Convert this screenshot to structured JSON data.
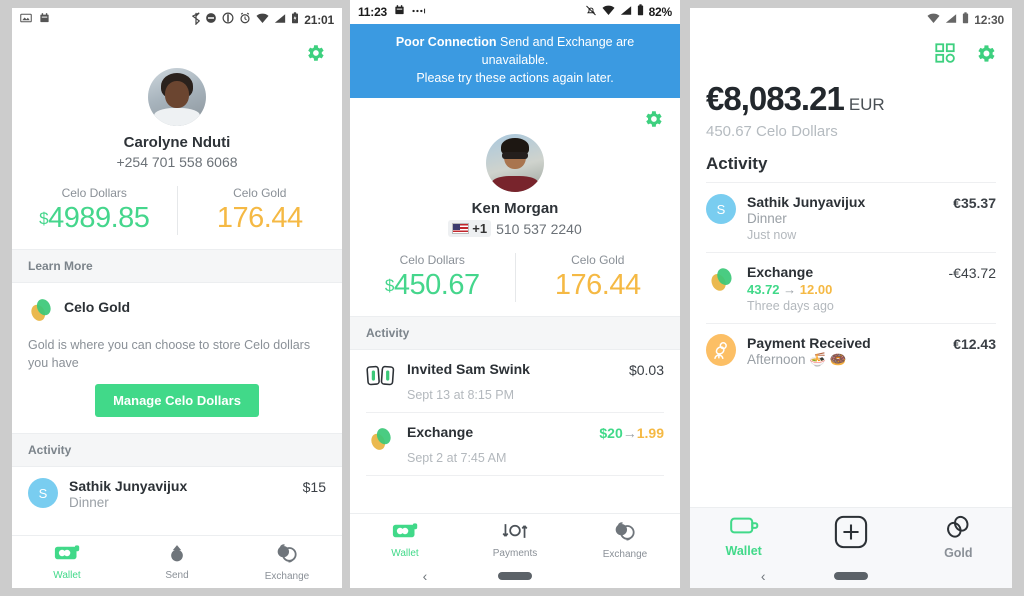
{
  "theme": {
    "green": "#41d989",
    "gold": "#f5b944",
    "banner_blue": "#3b9ae1",
    "avatar_blue": "#79cdf0",
    "avatar_orange": "#fcbf65",
    "page_bg": "#cccccc"
  },
  "phone1": {
    "statusbar": {
      "left_icons": [
        "image-icon",
        "calendar-icon"
      ],
      "right_icons": [
        "bluetooth-icon",
        "dnd-icon",
        "vibrate-icon",
        "alarm-icon",
        "wifi-icon",
        "signal-icon",
        "battery-icon"
      ],
      "time": "21:01"
    },
    "header": {
      "gear_icon": "gear-icon"
    },
    "profile": {
      "name": "Carolyne Nduti",
      "phone": "+254 701 558 6068"
    },
    "balances": [
      {
        "label": "Celo Dollars",
        "currency": "$",
        "value": "4989.85",
        "color": "green"
      },
      {
        "label": "Celo Gold",
        "currency": "",
        "value": "176.44",
        "color": "gold"
      }
    ],
    "learn_more": {
      "section_label": "Learn More",
      "card_icon": "celo-gold-icon",
      "title": "Celo Gold",
      "description": "Gold is where you can choose to store Celo dollars you have",
      "button_label": "Manage Celo Dollars"
    },
    "activity": {
      "section_label": "Activity",
      "rows": [
        {
          "icon": "avatar-initial",
          "initial": "S",
          "title": "Sathik Junyavijux",
          "subtitle": "Dinner",
          "amount": "$15"
        }
      ]
    },
    "tabs": [
      {
        "label": "Wallet",
        "icon": "wallet-icon",
        "active": true
      },
      {
        "label": "Send",
        "icon": "send-up-arrow-icon",
        "active": false
      },
      {
        "label": "Exchange",
        "icon": "exchange-icon",
        "active": false
      }
    ]
  },
  "phone2": {
    "statusbar": {
      "time": "11:23",
      "left_icons": [
        "calendar-icon",
        "more-dots-icon"
      ],
      "right_icons": [
        "notifications-off-icon",
        "wifi-icon",
        "signal-icon",
        "battery-icon"
      ],
      "battery": "82%"
    },
    "banner": {
      "bold": "Poor Connection",
      "rest": " Send and Exchange are unavailable.",
      "line2": "Please try these actions again later."
    },
    "header": {
      "gear_icon": "gear-icon"
    },
    "profile": {
      "name": "Ken Morgan",
      "country_code": "+1",
      "flag": "us-flag-icon",
      "phone": "510 537 2240"
    },
    "balances": [
      {
        "label": "Celo Dollars",
        "currency": "$",
        "value": "450.67",
        "color": "green"
      },
      {
        "label": "Celo Gold",
        "currency": "",
        "value": "176.44",
        "color": "gold"
      }
    ],
    "activity": {
      "section_label": "Activity",
      "rows": [
        {
          "icon": "invite-cards-icon",
          "title": "Invited Sam Swink",
          "amount": "$0.03",
          "subtitle": "Sept 13 at 8:15 PM"
        },
        {
          "icon": "celo-gold-icon",
          "title": "Exchange",
          "amount_from": "$20",
          "amount_arrow": "→",
          "amount_to": "1.99",
          "subtitle": "Sept 2 at 7:45 AM"
        }
      ]
    },
    "tabs": [
      {
        "label": "Wallet",
        "icon": "wallet-icon",
        "active": true
      },
      {
        "label": "Payments",
        "icon": "payments-arrows-icon",
        "active": false
      },
      {
        "label": "Exchange",
        "icon": "exchange-icon",
        "active": false
      }
    ],
    "sysnav": {
      "back": "‹",
      "home_pill": "home-pill-icon"
    }
  },
  "phone3": {
    "statusbar": {
      "right_icons": [
        "wifi-icon",
        "signal-icon",
        "battery-icon"
      ],
      "time": "12:30"
    },
    "header": {
      "qr_icon": "qr-scan-icon",
      "gear_icon": "gear-icon"
    },
    "balance": {
      "amount": "€8,083.21",
      "unit": "EUR",
      "sub": "450.67 Celo Dollars"
    },
    "activity": {
      "section_label": "Activity",
      "rows": [
        {
          "icon": "avatar-initial",
          "initial": "S",
          "title": "Sathik Junyavijux",
          "subtitle": "Dinner",
          "time": "Just now",
          "amount": "€35.37"
        },
        {
          "icon": "celo-gold-icon",
          "title": "Exchange",
          "exch_from": "43.72",
          "exch_arrow": "→",
          "exch_to": "12.00",
          "time": "Three days ago",
          "amount": "-€43.72"
        },
        {
          "icon": "payment-received-icon",
          "title": "Payment Received",
          "subtitle": "Afternoon 🍜 🍩",
          "amount": "€12.43"
        }
      ]
    },
    "tabs": [
      {
        "label": "Wallet",
        "icon": "wallet-outline-icon",
        "active": true
      },
      {
        "label": "",
        "icon": "plus-square-icon",
        "active": false
      },
      {
        "label": "Gold",
        "icon": "gold-rings-icon",
        "active": false
      }
    ],
    "sysnav": {
      "back": "‹",
      "home_pill": "home-pill-icon"
    }
  }
}
